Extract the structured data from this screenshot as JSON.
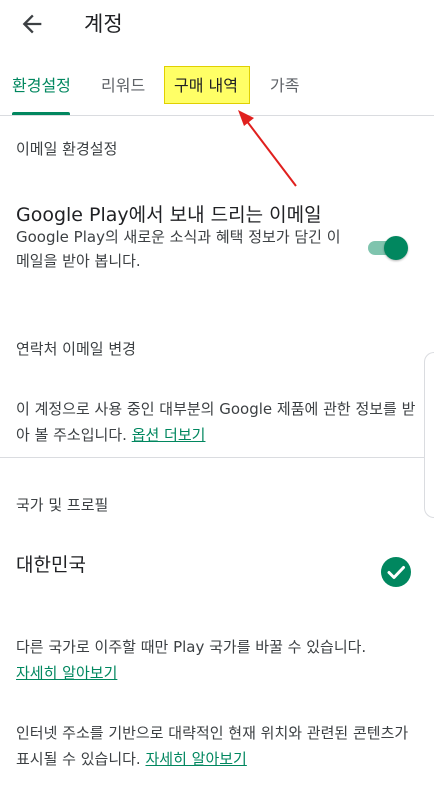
{
  "appbar": {
    "title": "계정",
    "back_icon": "arrow-back-icon"
  },
  "tabs": [
    {
      "label": "환경설정",
      "active": true
    },
    {
      "label": "리워드",
      "active": false
    },
    {
      "label": "구매 내역",
      "active": false,
      "highlighted": true
    },
    {
      "label": "가족",
      "active": false
    }
  ],
  "email_section": {
    "header": "이메일 환경설정",
    "title": "Google Play에서 보내 드리는 이메일",
    "desc": "Google Play의 새로운 소식과 혜택 정보가 담긴 이메일을 받아 봅니다.",
    "toggle_on": true
  },
  "contact_section": {
    "header": "연락처 이메일 변경",
    "text": "이 계정으로 사용 중인 대부분의 Google 제품에 관한 정보를 받아 볼 주소입니다. ",
    "link": "옵션 더보기"
  },
  "country_section": {
    "header": "국가 및 프로필",
    "country": "대한민국",
    "selected": true,
    "move_text": "다른 국가로 이주할 때만 Play 국가를 바꿀 수 있습니다.",
    "move_link": "자세히 알아보기",
    "ip_text": "인터넷 주소를 기반으로 대략적인 현재 위치와 관련된 콘텐츠가 표시될 수 있습니다. ",
    "ip_link": "자세히 알아보기"
  },
  "colors": {
    "accent": "#01875f",
    "highlight": "#ffff66",
    "annotation_arrow": "#e0201e"
  }
}
